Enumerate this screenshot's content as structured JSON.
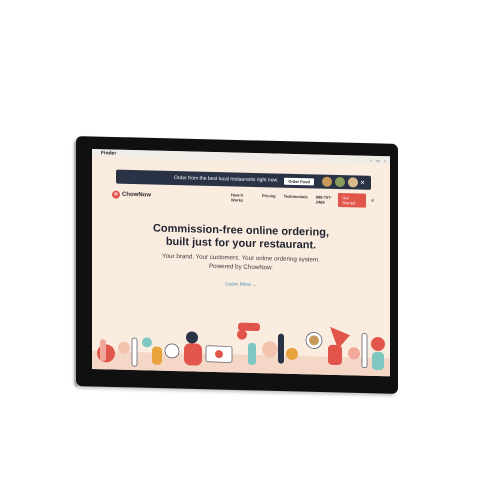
{
  "menubar": {
    "apple": "",
    "app": "Finder"
  },
  "promo": {
    "text": "Order from the best local restaurants right now.",
    "button": "Order Food",
    "close": "✕"
  },
  "nav": {
    "logo": "ChowNow",
    "links": [
      "How It Works",
      "Pricing",
      "Testimonials",
      "888-707-2469"
    ],
    "cta": "Get Started",
    "menu": "≡"
  },
  "hero": {
    "title_line1": "Commission-free online ordering,",
    "title_line2": "built just for your restaurant.",
    "sub_line1": "Your brand. Your customers. Your online ordering system.",
    "sub_line2": "Powered by ChowNow.",
    "learn_more": "Learn More ⌄"
  },
  "colors": {
    "brand": "#e2554b",
    "background": "#fbece0",
    "banner": "#2a3346",
    "link": "#4a8fb8"
  }
}
